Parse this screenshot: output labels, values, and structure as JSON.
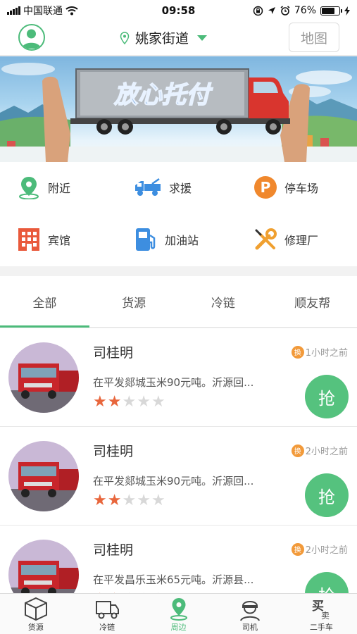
{
  "status_bar": {
    "carrier": "中国联通",
    "time": "09:58",
    "battery": "76%",
    "battery_level": 0.76
  },
  "header": {
    "location": "姚家街道",
    "map_button": "地图"
  },
  "banner": {
    "text": "放心托付"
  },
  "categories": [
    {
      "label": "附近",
      "icon": "location-pin-icon",
      "color": "#4cbb7a"
    },
    {
      "label": "求援",
      "icon": "tow-truck-icon",
      "color": "#3d8ee0"
    },
    {
      "label": "停车场",
      "icon": "parking-icon",
      "color": "#f0882d"
    },
    {
      "label": "宾馆",
      "icon": "hotel-icon",
      "color": "#e9593b"
    },
    {
      "label": "加油站",
      "icon": "gas-station-icon",
      "color": "#3d8ee0"
    },
    {
      "label": "修理厂",
      "icon": "repair-tools-icon",
      "color": "#f0a030"
    }
  ],
  "tabs": [
    {
      "label": "全部",
      "active": true
    },
    {
      "label": "货源",
      "active": false
    },
    {
      "label": "冷链",
      "active": false
    },
    {
      "label": "顺友帮",
      "active": false
    }
  ],
  "listings": [
    {
      "name": "司桂明",
      "badge": "换",
      "time": "1小时之前",
      "desc": "在平发郯城玉米90元吨。沂源回...",
      "rating": 2,
      "max_rating": 5,
      "button": "抢"
    },
    {
      "name": "司桂明",
      "badge": "换",
      "time": "2小时之前",
      "desc": "在平发郯城玉米90元吨。沂源回...",
      "rating": 2,
      "max_rating": 5,
      "button": "抢"
    },
    {
      "name": "司桂明",
      "badge": "换",
      "time": "2小时之前",
      "desc": "在平发昌乐玉米65元吨。沂源县...",
      "rating": 2,
      "max_rating": 5,
      "button": "抢"
    }
  ],
  "bottom_nav": [
    {
      "label": "货源",
      "icon": "cargo-box-icon",
      "active": false
    },
    {
      "label": "冷链",
      "icon": "cold-chain-truck-icon",
      "active": false
    },
    {
      "label": "周边",
      "icon": "nearby-pin-icon",
      "active": true
    },
    {
      "label": "司机",
      "icon": "driver-icon",
      "active": false
    },
    {
      "label": "二手车",
      "icon": "used-car-icon",
      "active": false
    }
  ],
  "colors": {
    "accent": "#4cbb7a",
    "star_on": "#e8663c",
    "star_off": "#d8d8d8"
  }
}
